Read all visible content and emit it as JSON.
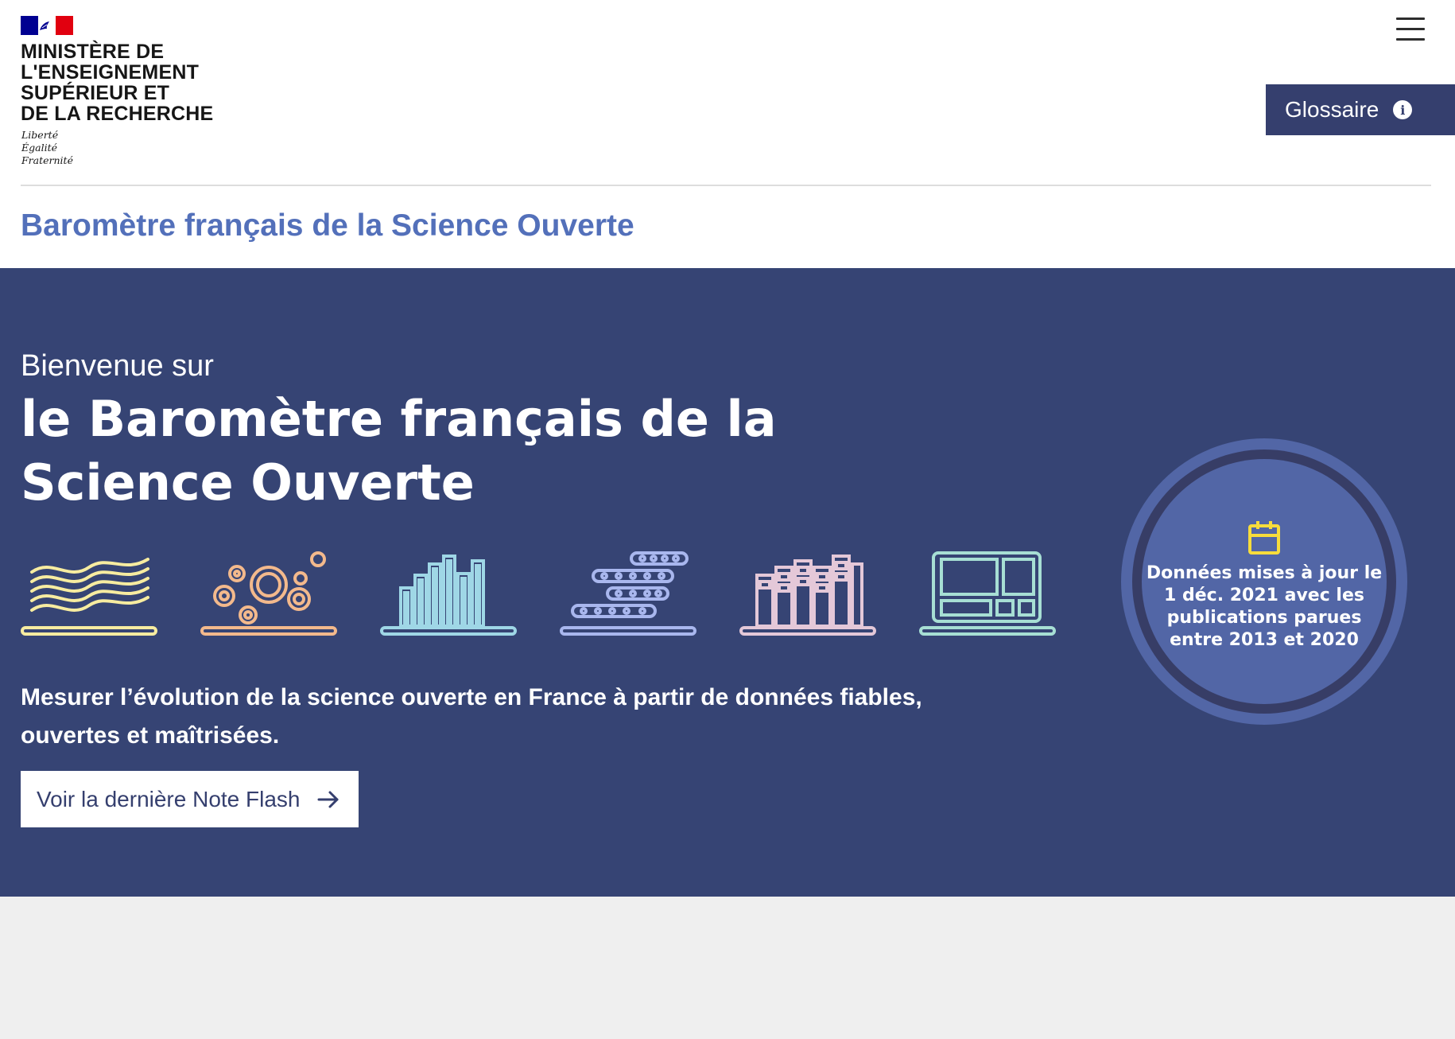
{
  "header": {
    "ministry_lines": [
      "MINISTÈRE DE",
      "L'ENSEIGNEMENT",
      "SUPÉRIEUR ET",
      "DE LA RECHERCHE"
    ],
    "motto_lines": [
      "Liberté",
      "Égalité",
      "Fraternité"
    ],
    "glossary_label": "Glossaire",
    "menu_icon": "hamburger-menu-icon",
    "site_title": "Baromètre français de la Science Ouverte"
  },
  "hero": {
    "welcome": "Bienvenue sur",
    "title": "le Baromètre français de la Science Ouverte",
    "tagline": "Mesurer l’évolution de la science ouverte en France à partir de données fiables, ouvertes et maîtrisées.",
    "cta_label": "Voir la dernière Note Flash",
    "icons": [
      {
        "name": "waves-icon",
        "color": "#f7eca0"
      },
      {
        "name": "bubbles-icon",
        "color": "#f3b98c"
      },
      {
        "name": "bar-chart-icon",
        "color": "#9fd7e6"
      },
      {
        "name": "timeline-icon",
        "color": "#a9b7ee"
      },
      {
        "name": "books-icon",
        "color": "#e4c8d8"
      },
      {
        "name": "dashboard-icon",
        "color": "#a7dfd4"
      }
    ],
    "badge": {
      "text": "Données mises à jour le 1 déc. 2021 avec les publications parues entre 2013 et 2020",
      "icon": "calendar-icon",
      "icon_color": "#f7dc3b"
    }
  },
  "colors": {
    "hero_bg": "#364474",
    "title_blue": "#5370ba",
    "button_dark": "#353f6e",
    "footer_bg": "#efefef"
  }
}
